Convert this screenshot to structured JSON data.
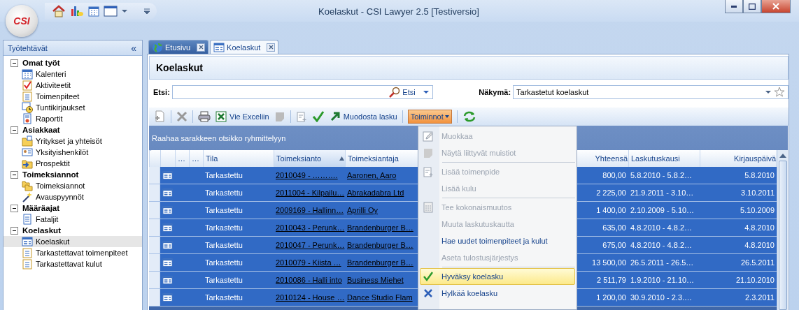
{
  "window": {
    "title": "Koelaskut - CSI Lawyer 2.5 [Testiversio]",
    "logo": "CSI"
  },
  "sidebar": {
    "title": "Työtehtävät",
    "collapse": "«",
    "groups": [
      {
        "label": "Omat työt",
        "expanded": true,
        "children": [
          {
            "label": "Kalenteri",
            "selected": false
          },
          {
            "label": "Aktiviteetit",
            "selected": false
          },
          {
            "label": "Toimenpiteet",
            "selected": false
          },
          {
            "label": "Tuntikirjaukset",
            "selected": false
          },
          {
            "label": "Raportit",
            "selected": false
          }
        ]
      },
      {
        "label": "Asiakkaat",
        "expanded": true,
        "children": [
          {
            "label": "Yritykset ja yhteisöt",
            "selected": false
          },
          {
            "label": "Yksityishenkilöt",
            "selected": false
          },
          {
            "label": "Prospektit",
            "selected": false
          }
        ]
      },
      {
        "label": "Toimeksiannot",
        "expanded": true,
        "children": [
          {
            "label": "Toimeksiannot",
            "selected": false
          },
          {
            "label": "Avauspyynnöt",
            "selected": false
          }
        ]
      },
      {
        "label": "Määräajat",
        "expanded": true,
        "children": [
          {
            "label": "Fataljit",
            "selected": false
          }
        ]
      },
      {
        "label": "Koelaskut",
        "expanded": true,
        "children": [
          {
            "label": "Koelaskut",
            "selected": true
          },
          {
            "label": "Tarkastettavat toimenpiteet",
            "selected": false
          },
          {
            "label": "Tarkastettavat kulut",
            "selected": false
          }
        ]
      }
    ]
  },
  "tabs": [
    {
      "label": "Etusivu",
      "selected": false
    },
    {
      "label": "Koelaskut",
      "selected": true
    }
  ],
  "page": {
    "title": "Koelaskut",
    "search": {
      "label": "Etsi:",
      "button": "Etsi"
    },
    "view": {
      "label": "Näkymä:",
      "value": "Tarkastetut koelaskut"
    }
  },
  "toolbar": {
    "export": "Vie Exceliin",
    "invoice": "Muodosta lasku",
    "actions": {
      "label": "Toiminnot",
      "expanded": true
    }
  },
  "table": {
    "group_hint": "Raahaa sarakkeen otsikko ryhmittelyyn",
    "columns": [
      {
        "label": "…",
        "sorted": false
      },
      {
        "label": "…",
        "sorted": false
      },
      {
        "label": "Tila",
        "sorted": false
      },
      {
        "label": "Toimeksianto",
        "sorted": true
      },
      {
        "label": "Toimeksiantaja",
        "sorted": false
      },
      {
        "label": "Yhteensä",
        "sorted": false
      },
      {
        "label": "Laskutuskausi",
        "sorted": false
      },
      {
        "label": "Kirjauspäivä",
        "sorted": false
      }
    ],
    "rows": [
      {
        "selected": true,
        "cells": [
          "",
          "",
          "Tarkastettu",
          "2010049 - ……….",
          "Aaronen, Aaro",
          "800,00",
          "5.8.2010 - 5.8.2…",
          "5.8.2010"
        ]
      },
      {
        "selected": true,
        "cells": [
          "",
          "",
          "Tarkastettu",
          "2011004 - Kilpailu…",
          "Abrakadabra Ltd",
          "2 225,00",
          "21.9.2011 - 3.10…",
          "3.10.2011"
        ]
      },
      {
        "selected": true,
        "cells": [
          "",
          "",
          "Tarkastettu",
          "2009169 - Hallinn…",
          "Aprilli Oy",
          "1 400,00",
          "2.10.2009 - 5.10…",
          "5.10.2009"
        ]
      },
      {
        "selected": true,
        "cells": [
          "",
          "",
          "Tarkastettu",
          "2010043 - Perunk…",
          "Brandenburger B…",
          "635,00",
          "4.8.2010 - 4.8.2…",
          "4.8.2010"
        ]
      },
      {
        "selected": true,
        "cells": [
          "",
          "",
          "Tarkastettu",
          "2010047 - Perunk…",
          "Brandenburger B…",
          "675,00",
          "4.8.2010 - 4.8.2…",
          "4.8.2010"
        ]
      },
      {
        "selected": true,
        "cells": [
          "",
          "",
          "Tarkastettu",
          "2010079 - Kiista …",
          "Brandenburger B…",
          "13 500,00",
          "26.5.2011 - 26.5…",
          "26.5.2011"
        ]
      },
      {
        "selected": true,
        "cells": [
          "",
          "",
          "Tarkastettu",
          "2010086 - Halli into",
          "Business Miehet",
          "2 511,79",
          "1.9.2010 - 21.10…",
          "21.10.2010"
        ]
      },
      {
        "selected": true,
        "cells": [
          "",
          "",
          "Tarkastettu",
          "2010124 - House …",
          "Dance Studio Flam",
          "1 200,00",
          "30.9.2010 - 2.3.…",
          "2.3.2011"
        ]
      }
    ]
  },
  "menu": {
    "items": [
      {
        "kind": "item",
        "label": "Muokkaa",
        "disabled": true,
        "selected": false
      },
      {
        "kind": "item",
        "label": "Näytä liittyvät muistiot",
        "disabled": true,
        "selected": false
      },
      {
        "kind": "separator"
      },
      {
        "kind": "item",
        "label": "Lisää toimenpide",
        "disabled": true,
        "selected": false
      },
      {
        "kind": "item",
        "label": "Lisää kulu",
        "disabled": true,
        "selected": false
      },
      {
        "kind": "separator"
      },
      {
        "kind": "item",
        "label": "Tee kokonaismuutos",
        "disabled": true,
        "selected": false
      },
      {
        "kind": "item",
        "label": "Muuta laskutuskautta",
        "disabled": true,
        "selected": false
      },
      {
        "kind": "item",
        "label": "Hae uudet toimenpiteet ja kulut",
        "disabled": false,
        "selected": false
      },
      {
        "kind": "item",
        "label": "Aseta tulostusjärjestys",
        "disabled": true,
        "selected": false
      },
      {
        "kind": "separator"
      },
      {
        "kind": "item",
        "label": "Hyväksy koelasku",
        "disabled": false,
        "selected": true
      },
      {
        "kind": "item",
        "label": "Hylkää koelasku",
        "disabled": false,
        "selected": false
      }
    ]
  }
}
